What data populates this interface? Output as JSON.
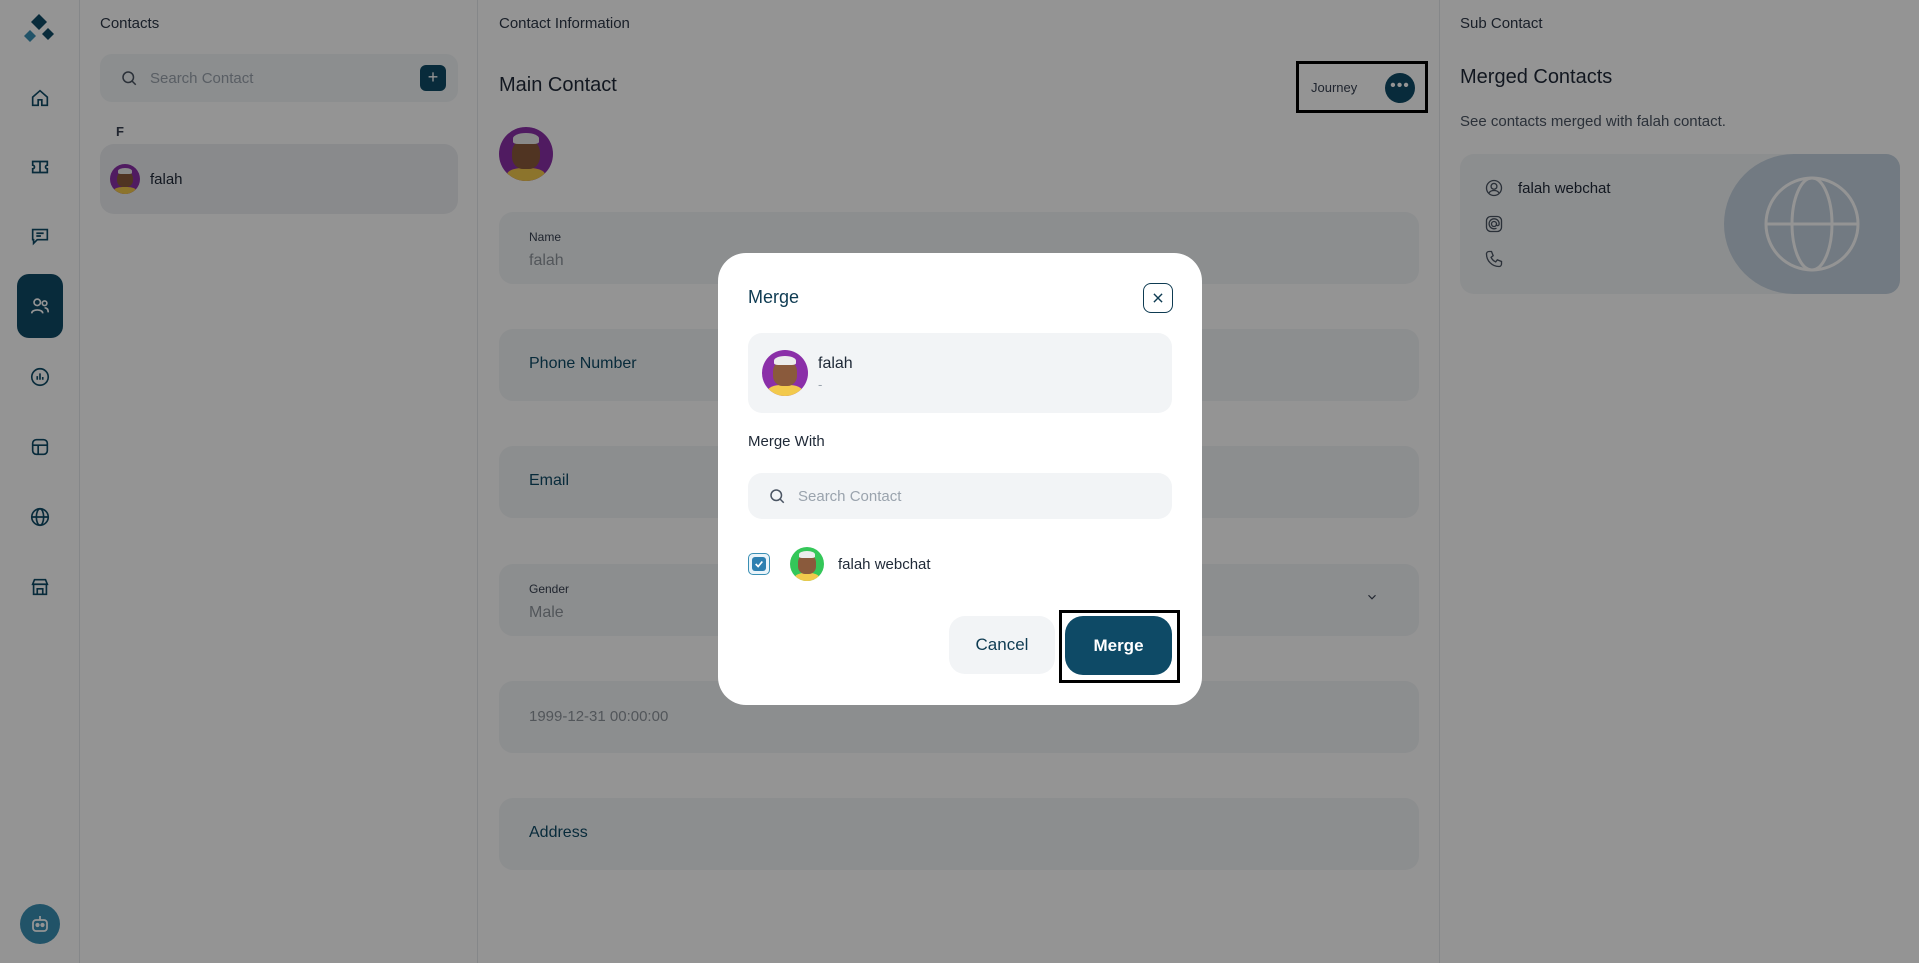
{
  "contacts_column": {
    "title": "Contacts",
    "search_placeholder": "Search Contact",
    "add_label": "+",
    "group_letter": "F",
    "items": [
      {
        "name": "falah"
      }
    ]
  },
  "main": {
    "section_title": "Contact Information",
    "subtitle": "Main Contact",
    "journey_label": "Journey",
    "more_label": "•••",
    "fields": {
      "name_label": "Name",
      "name_value": "falah",
      "phone_label": "Phone Number",
      "email_label": "Email",
      "gender_label": "Gender",
      "gender_value": "Male",
      "dob_value": "1999-12-31 00:00:00",
      "address_label": "Address"
    }
  },
  "sub_contact": {
    "title": "Sub Contact",
    "merged_title": "Merged Contacts",
    "merged_desc": "See contacts merged with falah contact.",
    "card_name": "falah webchat"
  },
  "modal": {
    "title": "Merge",
    "main_name": "falah",
    "main_sub": "-",
    "merge_with_label": "Merge With",
    "search_placeholder": "Search Contact",
    "candidate_name": "falah webchat",
    "candidate_checked": true,
    "cancel_label": "Cancel",
    "merge_label": "Merge"
  },
  "colors": {
    "primary": "#0e4a66",
    "overlay": "rgba(0,0,0,0.42)",
    "field_bg": "#f2f4f6"
  },
  "icons": {
    "rail": [
      "home-icon",
      "ticket-icon",
      "chat-icon",
      "contacts-icon",
      "reports-icon",
      "templates-icon",
      "globe-icon",
      "store-icon"
    ]
  }
}
